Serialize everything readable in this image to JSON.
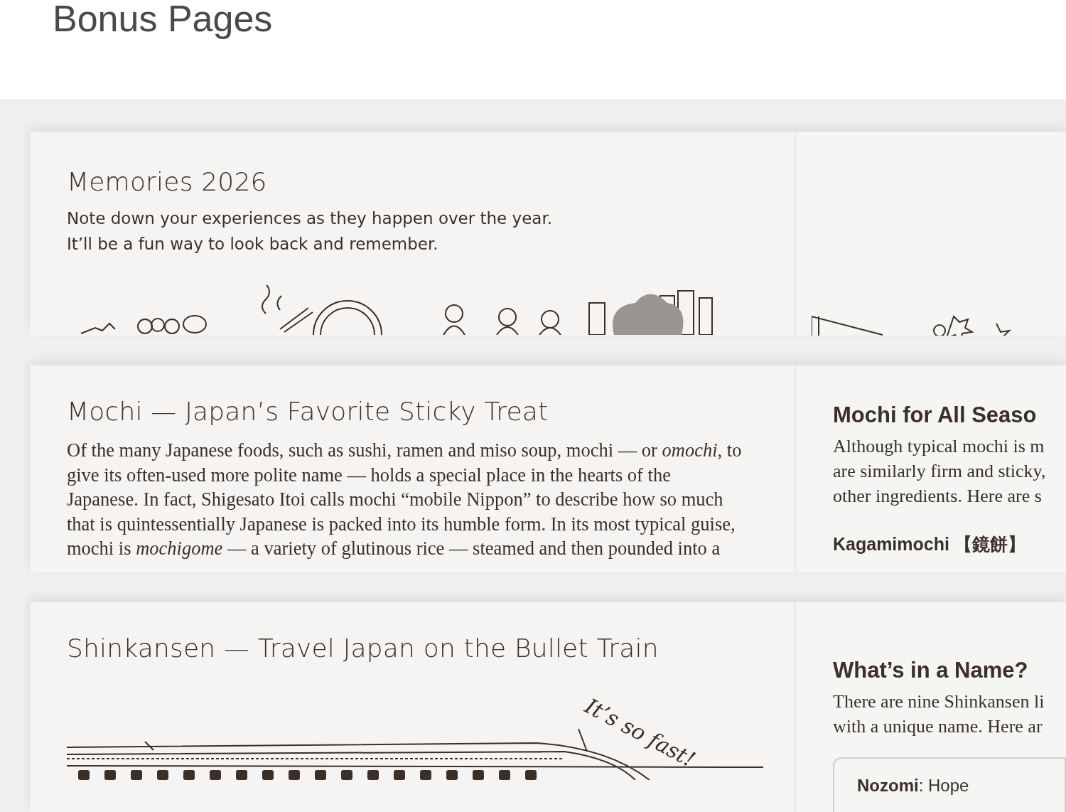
{
  "page_title": "Bonus Pages",
  "spreads": [
    {
      "kind": "memories",
      "left": {
        "title": "Memories 2026",
        "lines": [
          "Note down your experiences as they happen over the year.",
          "It’ll be a fun way to look back and remember."
        ]
      }
    },
    {
      "kind": "mochi",
      "left": {
        "title": "Mochi — Japan’s Favorite Sticky Treat",
        "paragraph": "Of the many Japanese foods, such as sushi, ramen and miso soup, mochi — or *omochi*, to give its often-used more polite name — holds a special place in the hearts of the Japanese. In fact, Shigesato Itoi calls mochi “mobile Nippon” to describe how so much that is quintessentially Japanese is packed into its humble form. In its most typical guise, mochi is *mochigome* — a variety of glutinous rice — steamed and then pounded into a"
      },
      "right": {
        "heading": "Mochi for All Seaso",
        "lines": [
          "Although typical mochi is m",
          "are similarly firm and sticky,",
          "other ingredients. Here are s"
        ],
        "subheading": "Kagamimochi 【鏡餅】"
      }
    },
    {
      "kind": "train",
      "left": {
        "title": "Shinkansen — Travel Japan on the Bullet Train",
        "caption": "It’s so fast!"
      },
      "right": {
        "heading": "What’s in a Name?",
        "lines": [
          "There are nine Shinkansen li",
          "with a unique name. Here ar"
        ],
        "note": {
          "term": "Nozomi",
          "meaning": ": Hope"
        }
      }
    }
  ]
}
